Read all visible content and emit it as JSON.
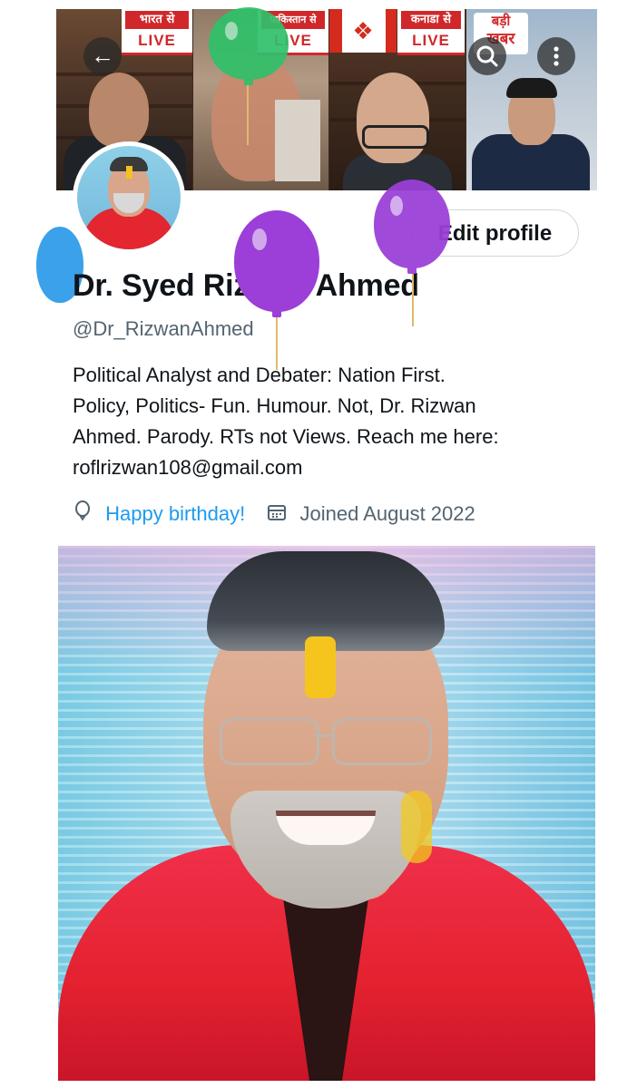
{
  "banner": {
    "tags": [
      {
        "hindi": "भारत से",
        "english": "LIVE"
      },
      {
        "hindi": "पाकिस्तान से",
        "english": "LIVE"
      },
      {
        "hindi": "कनाडा से",
        "english": "LIVE"
      },
      {
        "hindi": "बड़ी",
        "english": "खबर"
      }
    ],
    "icons": {
      "back": "back-arrow-icon",
      "search": "search-icon",
      "more": "more-vertical-icon"
    }
  },
  "profile": {
    "edit_button": "Edit profile",
    "name": "Dr. Syed Rizwan Ahmed",
    "handle": "@Dr_RizwanAhmed",
    "bio_lines": [
      "Political Analyst and Debater: Nation First.",
      "Policy, Politics- Fun. Humour. Not, Dr. Rizwan",
      "Ahmed. Parody. RTs not Views. Reach me here:",
      "roflrizwan108@gmail.com"
    ],
    "birthday": "Happy birthday!",
    "joined": "Joined August 2022"
  },
  "colors": {
    "accent": "#1d9bf0",
    "text": "#0f1419",
    "muted": "#536471",
    "live_red": "#d0282a"
  }
}
